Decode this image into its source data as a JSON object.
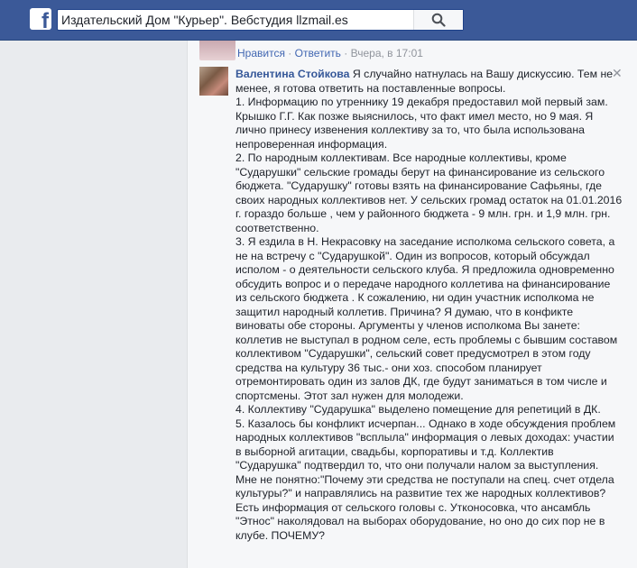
{
  "header": {
    "logo": "f",
    "search_value": "Издательский Дом \"Курьер\". Вебстудия llzmail.es"
  },
  "previous_comment": {
    "like": "Нравится",
    "separator": "·",
    "reply": "Ответить",
    "time": "Вчера, в 17:01"
  },
  "comment": {
    "author": "Валентина Стойкова",
    "first_line": "Я случайно натнулась на Вашу дискуссию. Тем не",
    "lines": [
      "менее, я готова ответить на поставленные вопросы.",
      "1. Информацию по утреннику 19 декабря предоставил мой первый зам.",
      "Крышко Г.Г. Как позже выяснилось, что факт имел место, но 9 мая. Я",
      "лично принесу извенения коллективу за то, что была использована",
      "непроверенная информация.",
      "2. По народным коллективам. Все народные коллективы, кроме",
      "\"Сударушки\" сельские громады берут на финансирование из сельского",
      "бюджета. \"Сударушку\" готовы взять на финансирование Сафьяны, где",
      "своих народных коллективов нет. У сельских громад остаток на 01.01.2016",
      "г. гораздо больше , чем у районного бюджета - 9 млн. грн. и 1,9 млн. грн.",
      "соответственно.",
      "3. Я ездила в Н. Некрасовку на заседание исполкома сельского совета, а",
      "не на встречу с \"Сударушкой\". Один из вопросов, который обсуждал",
      "исполом - о деятельности сельского клуба. Я предложила одновременно",
      "обсудить вопрос и о передаче народного коллетива на финансирование",
      "из сельского бюджета . К сожалению, ни один участник исполкома не",
      "защитил народный коллетив. Причина? Я думаю, что в конфикте",
      "виноваты обе стороны. Аргументы у членов исполкома Вы занете:",
      "коллетив не выступал в родном селе, есть проблемы с бывшим составом",
      "коллективом \"Сударушки\", сельский совет предусмотрел в этом году",
      "средства на культуру 36 тыс.- они хоз. способом планирует",
      "отремонтировать один из залов ДК, где будут заниматься в том числе и",
      "спортсмены. Этот зал нужен для молодежи.",
      "4. Коллективу \"Сударушка\" выделено помещение для репетиций в ДК.",
      "5. Казалось бы конфликт исчерпан... Однако в ходе обсуждения проблем",
      "народных коллективов \"всплыла\" информация о левых доходах: участии",
      "в выборной агитации, свадьбы, корпоративы и т.д. Коллектив",
      "\"Сударушка\" подтвердил то, что они получали налом за выступления.",
      "Мне не понятно:\"Почему эти средства не поступали на спец. счет отдела",
      "культуры?\" и направлялись на развитие тех же народных коллективов?",
      "Есть информация от сельского головы с. Утконосовка, что ансамбль",
      "\"Этнос\" наколядовал на выборах оборудование, но оно до сих пор не в",
      "клубе. ПОЧЕМУ?"
    ]
  },
  "icons": {
    "search": "magnifier-icon",
    "close": "close-icon"
  }
}
